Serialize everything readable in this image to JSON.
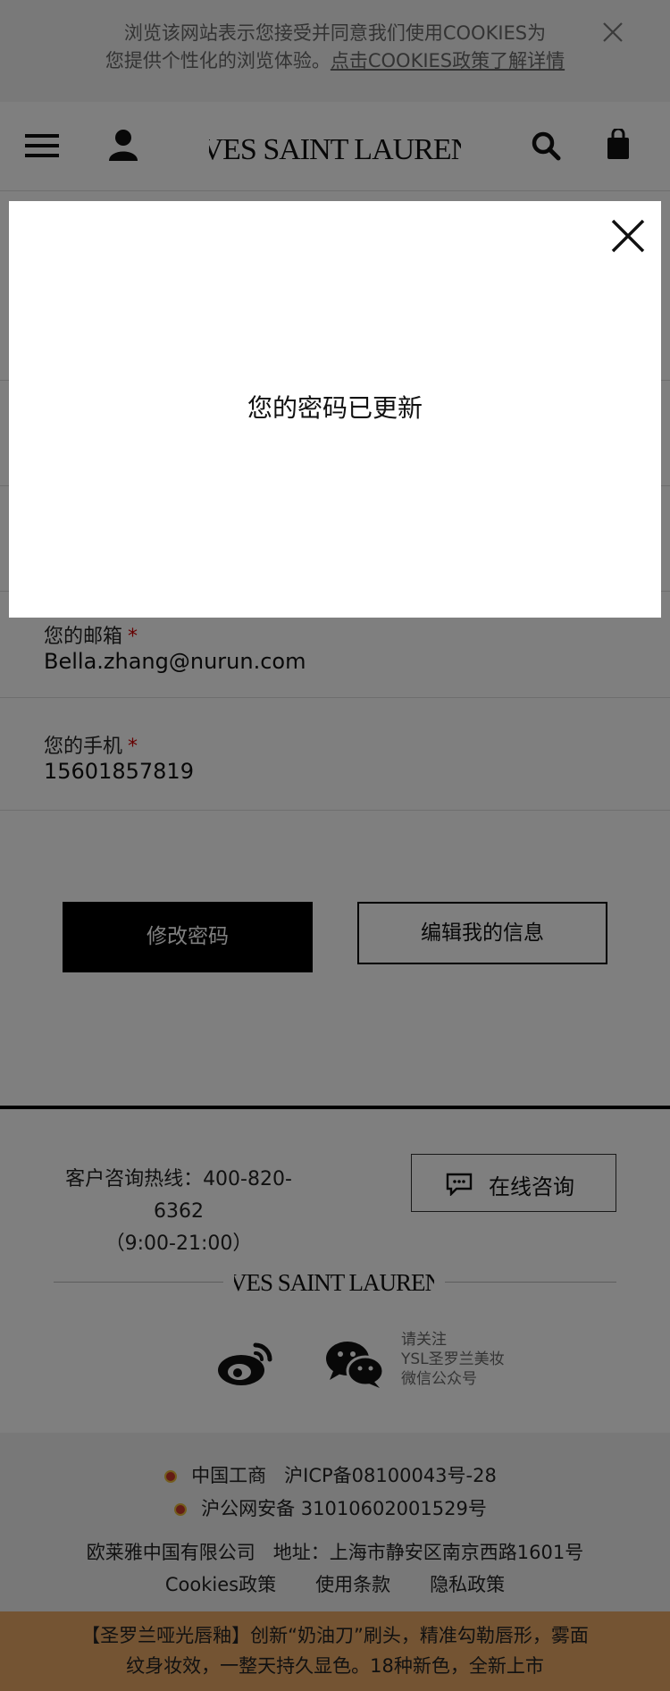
{
  "cookie_banner": {
    "line1": "浏览该网站表示您接受并同意我们使用COOKIES为",
    "line2_prefix": "您提供个性化的浏览体验。",
    "line2_link": "点击COOKIES政策了解详情"
  },
  "header": {
    "menu_icon": "hamburger-menu-icon",
    "account_icon": "user-icon",
    "logo_text": "YVES SAINT LAURENT",
    "search_icon": "search-icon",
    "bag_icon": "shopping-bag-icon"
  },
  "form": {
    "email_label": "您的邮箱",
    "email_value": "Bella.zhang@nurun.com",
    "phone_label": "您的手机",
    "phone_value": "15601857819",
    "required_mark": "*"
  },
  "buttons": {
    "change_password": "修改密码",
    "edit_info": "编辑我的信息"
  },
  "footer": {
    "hotline_line1": "客户咨询热线：400-820-6362",
    "hotline_line2": "（9:00-21:00）",
    "chat_label": "在线咨询",
    "logo_text": "YVES SAINT LAURENT",
    "wechat_line1": "请关注",
    "wechat_line2": "YSL圣罗兰美妆",
    "wechat_line3": "微信公众号",
    "legal_line1_a": "中国工商",
    "legal_line1_b": "沪ICP备08100043号-28",
    "legal_line2": "沪公网安备 31010602001529号",
    "company": "欧莱雅中国有限公司",
    "address": "地址：上海市静安区南京西路1601号",
    "link_cookies": "Cookies政策",
    "link_terms": "使用条款",
    "link_privacy": "隐私政策"
  },
  "promo": {
    "line1": "【圣罗兰哑光唇釉】创新“奶油刀”刷头，精准勾勒唇形，雾面",
    "line2": "纹身妆效，一整天持久显色。18种新色，全新上市"
  },
  "modal": {
    "message": "您的密码已更新",
    "close_icon": "close-icon"
  },
  "colors": {
    "promo_bar": "#e9a866",
    "required": "#cc0000",
    "overlay": "rgba(0,0,0,0.5)"
  }
}
